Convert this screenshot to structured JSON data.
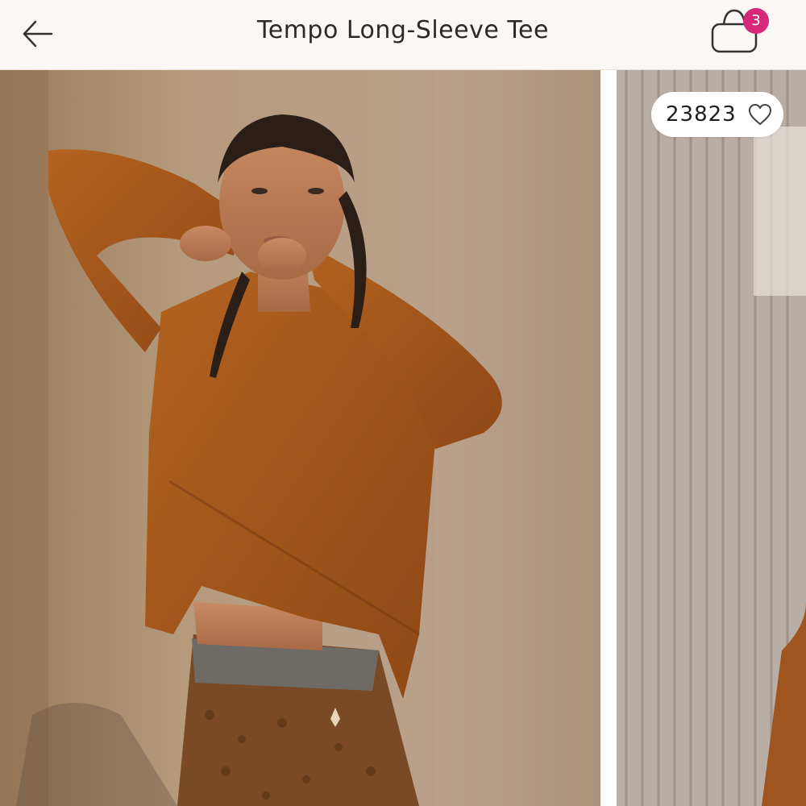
{
  "header": {
    "title": "Tempo Long-Sleeve Tee",
    "bag_count": "3"
  },
  "gallery": {
    "likes": "23823"
  },
  "colors": {
    "accent": "#d6287a",
    "shirt": "#a0541e",
    "background": "#faf7f4"
  }
}
